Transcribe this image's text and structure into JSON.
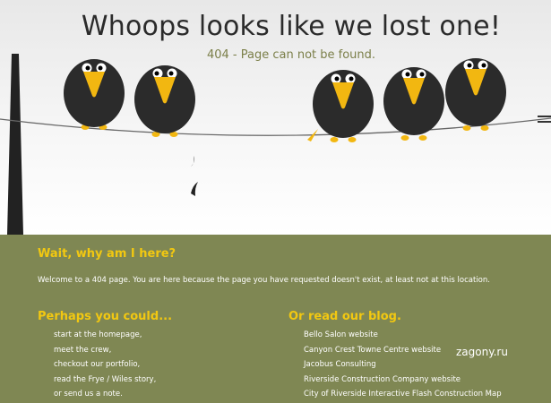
{
  "header": {
    "title": "Whoops looks like we lost one!",
    "subtitle": "404 - Page can not be found."
  },
  "colors": {
    "footer_bg": "#7f8753",
    "heading_yellow": "#f2c811",
    "subtitle_olive": "#7b7f49",
    "crow_body": "#2b2b2b",
    "beak": "#f2b711"
  },
  "illustration": {
    "icons": [
      "utility-pole-icon",
      "crow-icon",
      "power-line-icon",
      "falling-feather-icon"
    ]
  },
  "info": {
    "title": "Wait, why am I here?",
    "text": "Welcome to a 404 page. You are here because the page you have requested doesn't exist, at least not at this location."
  },
  "suggestions": {
    "title": "Perhaps you could...",
    "items": [
      "start at the homepage,",
      "meet the crew,",
      "checkout our portfolio,",
      "read the Frye / Wiles story,",
      "or send us a note."
    ]
  },
  "blog": {
    "title": "Or read our blog.",
    "items": [
      "Bello Salon website",
      "Canyon Crest Towne Centre website",
      "Jacobus Consulting",
      "Riverside Construction Company website",
      "City of Riverside Interactive Flash Construction Map"
    ]
  },
  "watermark": "zagony.ru"
}
